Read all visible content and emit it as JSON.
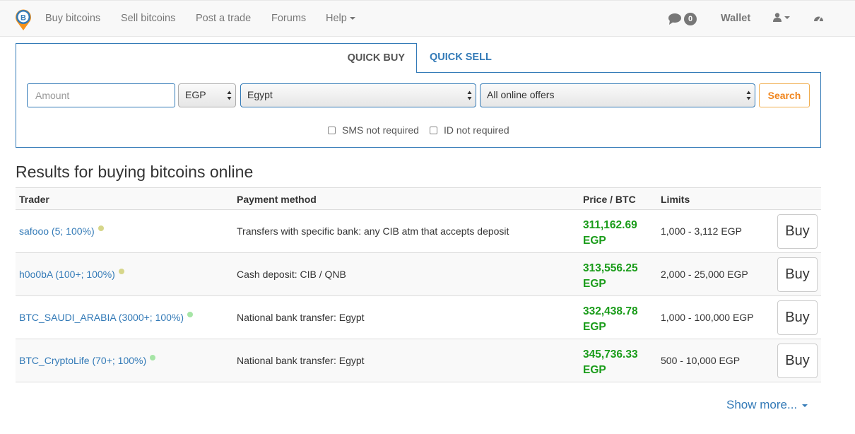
{
  "nav": {
    "links": [
      "Buy bitcoins",
      "Sell bitcoins",
      "Post a trade",
      "Forums",
      "Help"
    ],
    "chat_count": "0",
    "wallet": "Wallet"
  },
  "quick": {
    "tab_buy": "QUICK BUY",
    "tab_sell": "QUICK SELL",
    "amount_placeholder": "Amount",
    "currency": "EGP",
    "country": "Egypt",
    "offer_type": "All online offers",
    "search": "Search",
    "sms_label": "SMS not required",
    "id_label": "ID not required"
  },
  "results": {
    "title": "Results for buying bitcoins online",
    "headers": {
      "trader": "Trader",
      "payment": "Payment method",
      "price": "Price / BTC",
      "limits": "Limits"
    },
    "rows": [
      {
        "trader": "safooo (5; 100%)",
        "dot": "#d6d68a",
        "payment": "Transfers with specific bank: any CIB atm that accepts deposit",
        "price": "311,162.69",
        "currency": "EGP",
        "limits": "1,000 - 3,112 EGP",
        "action": "Buy"
      },
      {
        "trader": "h0o0bA (100+; 100%)",
        "dot": "#d6d68a",
        "payment": "Cash deposit: CIB / QNB",
        "price": "313,556.25",
        "currency": "EGP",
        "limits": "2,000 - 25,000 EGP",
        "action": "Buy"
      },
      {
        "trader": "BTC_SAUDI_ARABIA (3000+; 100%)",
        "dot": "#a6e5a6",
        "payment": "National bank transfer: Egypt",
        "price": "332,438.78",
        "currency": "EGP",
        "limits": "1,000 - 100,000 EGP",
        "action": "Buy"
      },
      {
        "trader": "BTC_CryptoLife (70+; 100%)",
        "dot": "#a6e5a6",
        "payment": "National bank transfer: Egypt",
        "price": "345,736.33",
        "currency": "EGP",
        "limits": "500 - 10,000 EGP",
        "action": "Buy"
      }
    ],
    "show_more": "Show more..."
  },
  "colors": {
    "primary": "#337ab7",
    "price_green": "#1a9c1a",
    "search_orange": "#f0851d"
  }
}
